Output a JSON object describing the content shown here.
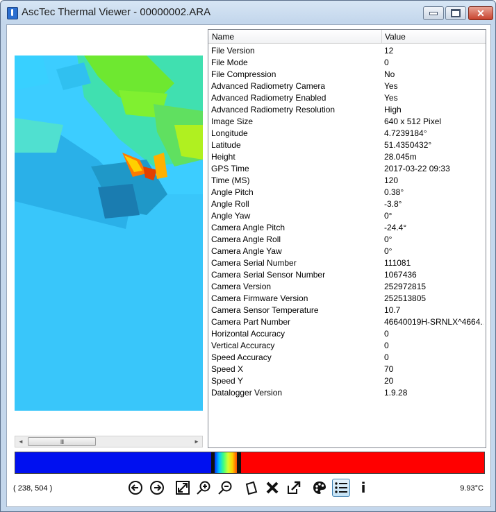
{
  "window": {
    "title": "AscTec Thermal Viewer - 00000002.ARA",
    "minimize_icon": "minimize-icon",
    "maximize_icon": "maximize-icon",
    "close_icon": "close-icon"
  },
  "properties": {
    "columns": [
      "Name",
      "Value"
    ],
    "rows": [
      {
        "name": "File Version",
        "value": "12"
      },
      {
        "name": "File Mode",
        "value": "0"
      },
      {
        "name": "File Compression",
        "value": "No"
      },
      {
        "name": "Advanced Radiometry Camera",
        "value": "Yes"
      },
      {
        "name": "Advanced Radiometry Enabled",
        "value": "Yes"
      },
      {
        "name": "Advanced Radiometry Resolution",
        "value": "High"
      },
      {
        "name": "Image Size",
        "value": "640 x 512 Pixel"
      },
      {
        "name": "Longitude",
        "value": "4.7239184°"
      },
      {
        "name": "Latitude",
        "value": "51.4350432°"
      },
      {
        "name": "Height",
        "value": "28.045m"
      },
      {
        "name": "GPS Time",
        "value": "2017-03-22 09:33"
      },
      {
        "name": "Time (MS)",
        "value": "120"
      },
      {
        "name": "Angle Pitch",
        "value": "0.38°"
      },
      {
        "name": "Angle Roll",
        "value": "-3.8°"
      },
      {
        "name": "Angle Yaw",
        "value": "0°"
      },
      {
        "name": "Camera Angle Pitch",
        "value": "-24.4°"
      },
      {
        "name": "Camera Angle Roll",
        "value": "0°"
      },
      {
        "name": "Camera Angle Yaw",
        "value": "0°"
      },
      {
        "name": "Camera Serial Number",
        "value": "111081"
      },
      {
        "name": "Camera Serial Sensor Number",
        "value": "1067436"
      },
      {
        "name": "Camera Version",
        "value": "252972815"
      },
      {
        "name": "Camera Firmware Version",
        "value": "252513805"
      },
      {
        "name": "Camera Sensor Temperature",
        "value": "10.7"
      },
      {
        "name": "Camera Part Number",
        "value": "46640019H-SRNLX^4664..."
      },
      {
        "name": "Horizontal Accuracy",
        "value": "0"
      },
      {
        "name": "Vertical Accuracy",
        "value": "0"
      },
      {
        "name": "Speed Accuracy",
        "value": "0"
      },
      {
        "name": "Speed X",
        "value": "70"
      },
      {
        "name": "Speed Y",
        "value": "20"
      },
      {
        "name": "Datalogger Version",
        "value": "1.9.28"
      }
    ]
  },
  "scrollbar": {
    "thumb_grip": "III"
  },
  "status": {
    "cursor_coords": "( 238, 504 )",
    "temperature": "9.93°C"
  },
  "toolbar": {
    "icons": [
      "previous-icon",
      "next-icon",
      "fit-to-window-icon",
      "zoom-in-icon",
      "zoom-out-icon",
      "rotate-icon",
      "delete-icon",
      "export-icon",
      "palette-icon",
      "properties-list-icon",
      "info-icon"
    ],
    "info_label": "i"
  },
  "colors": {
    "colorbar_low": "#0010f0",
    "colorbar_high": "#ff0000",
    "selected_tool": "#3c7fb1"
  }
}
